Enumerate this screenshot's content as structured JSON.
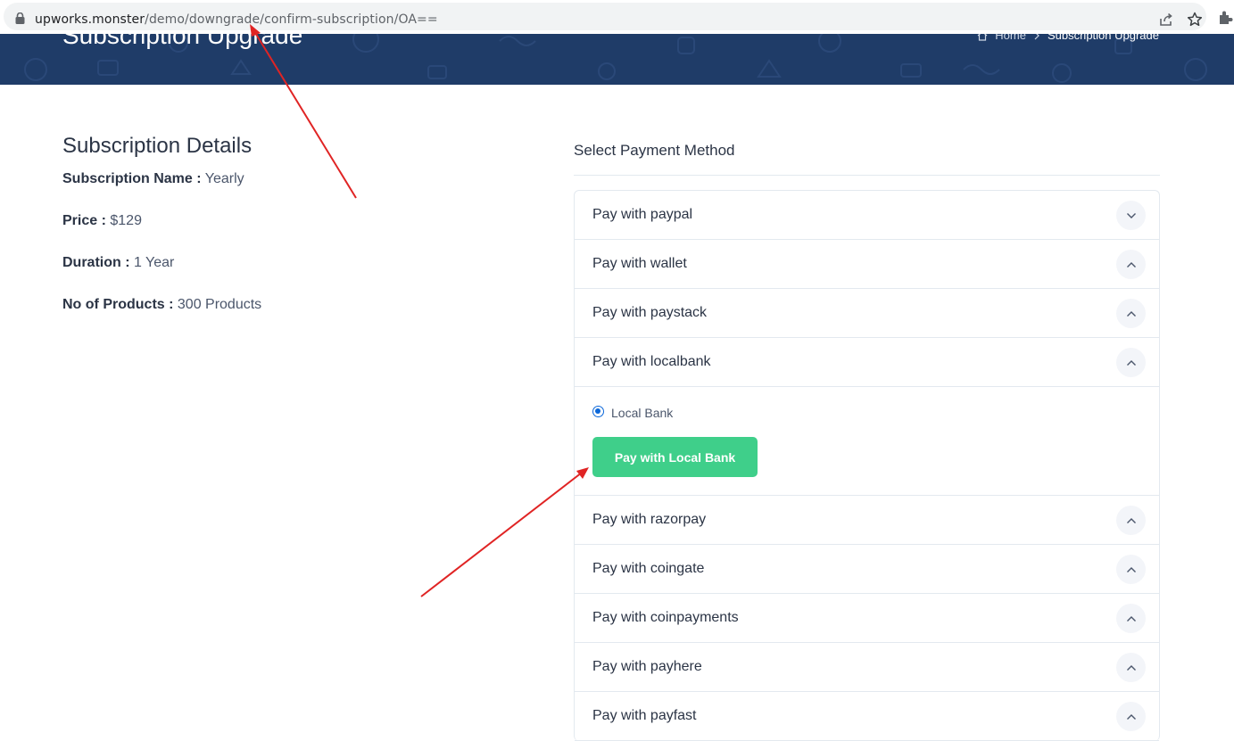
{
  "browser": {
    "url_host": "upworks.monster",
    "url_path": "/demo/downgrade/confirm-subscription/OA==",
    "icons": [
      "lock-icon",
      "share-icon",
      "star-icon",
      "extensions-icon"
    ]
  },
  "banner": {
    "title": "Subscription Upgrade",
    "breadcrumb": {
      "home": "Home",
      "current": "Subscription Upgrade"
    }
  },
  "details": {
    "heading": "Subscription Details",
    "rows": [
      {
        "label": "Subscription Name :",
        "value": "Yearly"
      },
      {
        "label": "Price :",
        "value": "$129"
      },
      {
        "label": "Duration :",
        "value": "1 Year"
      },
      {
        "label": "No of Products :",
        "value": "300 Products"
      }
    ]
  },
  "payment": {
    "heading": "Select Payment Method",
    "methods": [
      {
        "label": "Pay with paypal",
        "chevron": "down"
      },
      {
        "label": "Pay with wallet",
        "chevron": "up"
      },
      {
        "label": "Pay with paystack",
        "chevron": "up"
      },
      {
        "label": "Pay with localbank",
        "chevron": "up"
      },
      {
        "label": "Pay with razorpay",
        "chevron": "up"
      },
      {
        "label": "Pay with coingate",
        "chevron": "up"
      },
      {
        "label": "Pay with coinpayments",
        "chevron": "up"
      },
      {
        "label": "Pay with payhere",
        "chevron": "up"
      },
      {
        "label": "Pay with payfast",
        "chevron": "up"
      }
    ],
    "localbank": {
      "radio_label": "Local Bank",
      "button_label": "Pay with Local Bank"
    }
  },
  "colors": {
    "banner": "#1f3c68",
    "button": "#3fcf8a",
    "annotation_arrow": "#e02424"
  }
}
